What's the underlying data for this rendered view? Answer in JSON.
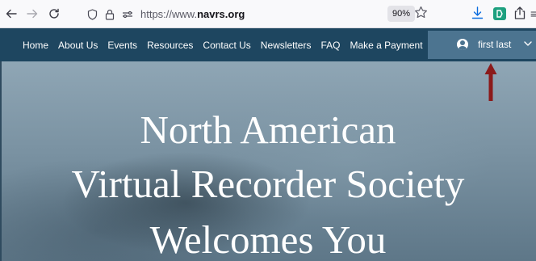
{
  "browser": {
    "url_prefix": "https://www.",
    "url_domain": "navrs.org",
    "zoom": "90%",
    "icons": [
      "back-arrow-icon",
      "forward-arrow-icon",
      "reload-icon",
      "shield-icon",
      "lock-icon",
      "permissions-icon",
      "bookmark-star-icon",
      "download-icon",
      "extension-icon",
      "share-icon"
    ]
  },
  "nav": {
    "items": [
      {
        "label": "Home"
      },
      {
        "label": "About Us"
      },
      {
        "label": "Events"
      },
      {
        "label": "Resources"
      },
      {
        "label": "Contact Us"
      },
      {
        "label": "Newsletters"
      },
      {
        "label": "FAQ"
      },
      {
        "label": "Make a Payment"
      }
    ],
    "user_name": "first last",
    "colors": {
      "nav_bg": "#1e4660",
      "user_bg": "#4c7490"
    }
  },
  "hero": {
    "line1": "North American",
    "line2": "Virtual Recorder Society",
    "line3": "Welcomes You"
  },
  "annotation": {
    "arrow_color": "#8b1a1a"
  }
}
